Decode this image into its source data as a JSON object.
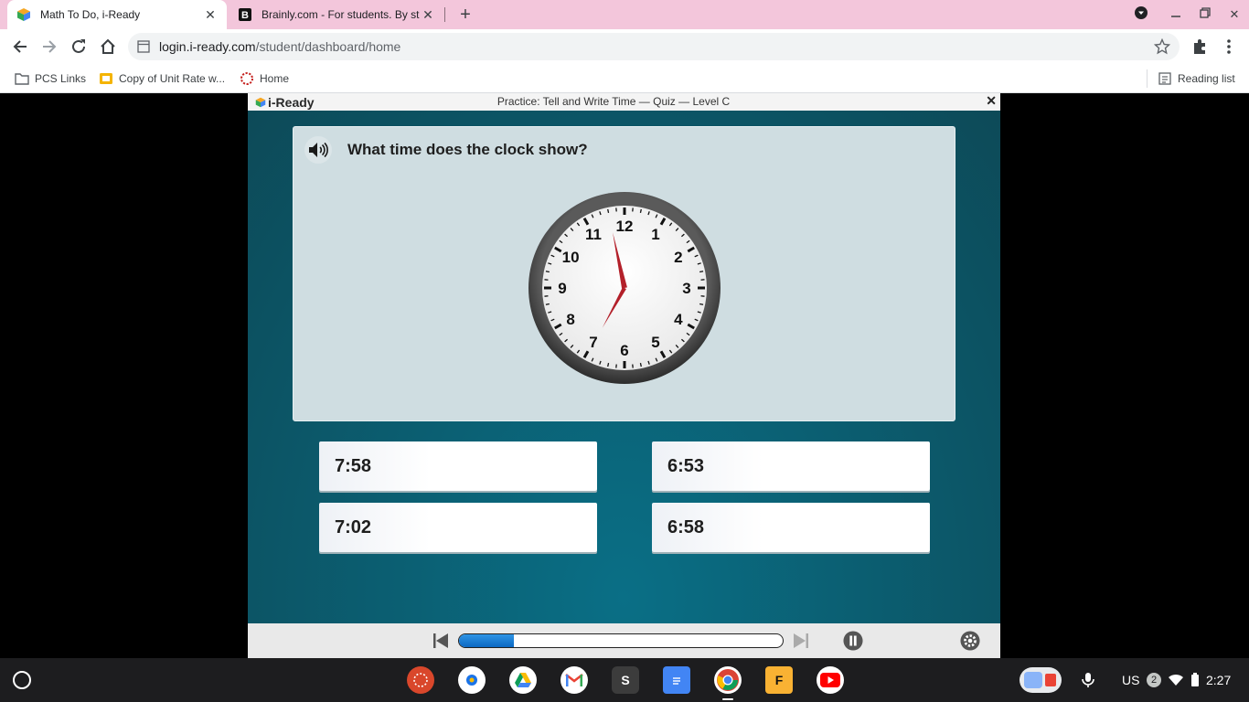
{
  "browser": {
    "tabs": [
      {
        "title": "Math To Do, i-Ready",
        "active": true
      },
      {
        "title": "Brainly.com - For students. By st",
        "active": false
      }
    ],
    "url_host": "login.i-ready.com",
    "url_path": "/student/dashboard/home",
    "bookmarks": [
      "PCS Links",
      "Copy of Unit Rate w...",
      "Home"
    ],
    "reading_list": "Reading list"
  },
  "iready": {
    "logo": "i-Ready",
    "lesson_title": "Practice: Tell and Write Time — Quiz — Level C",
    "close": "✕",
    "question": "What time does the clock show?",
    "clock": {
      "numbers": [
        "12",
        "1",
        "2",
        "3",
        "4",
        "5",
        "6",
        "7",
        "8",
        "9",
        "10",
        "11"
      ],
      "hour": 6,
      "minute": 58,
      "hand_color": "#b3202a"
    },
    "answers": [
      "7:58",
      "6:53",
      "7:02",
      "6:58"
    ],
    "progress_fraction": 0.17
  },
  "shelf": {
    "apps": [
      "Citrix",
      "Chrome Remote",
      "Google Drive",
      "Gmail",
      "S",
      "Google Docs",
      "Chrome",
      "Flipgrid",
      "YouTube"
    ],
    "s_label": "S",
    "f_label": "F",
    "locale": "US",
    "notifications": "2",
    "time": "2:27"
  },
  "colors": {
    "tab_strip": "#f3c6db",
    "stage_teal": "#0b5e71",
    "progress_blue": "#0b68c2"
  }
}
